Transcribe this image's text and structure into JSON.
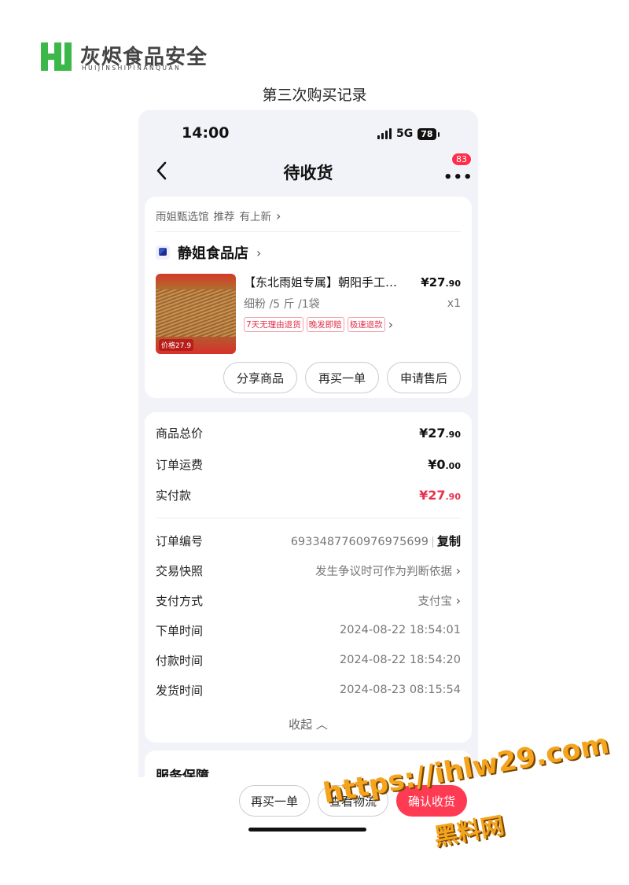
{
  "brand": {
    "name": "灰烬食品安全",
    "sub": "HUIJINSHIPINANQUAN",
    "color": "#3cb84a"
  },
  "caption": "第三次购买记录",
  "status": {
    "time": "14:00",
    "network": "5G",
    "battery": "78"
  },
  "nav": {
    "back_icon": "chevron-left-icon",
    "title": "待收货",
    "more_badge": "83"
  },
  "recommend": {
    "source": "雨姐甄选馆",
    "tag": "推荐",
    "new": "有上新"
  },
  "shop": {
    "name": "静姐食品店"
  },
  "product": {
    "title": "【东北雨姐专属】朝阳手工粉条",
    "price_int": "¥27",
    "price_dec": ".90",
    "spec": "细粉 /5 斤 /1袋",
    "qty": "x1",
    "img_price": "价格27.9",
    "tags": [
      "7天无理由退货",
      "晚发即赔",
      "极速退款"
    ]
  },
  "actions": {
    "share": "分享商品",
    "rebuy": "再买一单",
    "aftersale": "申请售后"
  },
  "summary": {
    "total_label": "商品总价",
    "total_int": "¥27",
    "total_dec": ".90",
    "ship_label": "订单运费",
    "ship_int": "¥0",
    "ship_dec": ".00",
    "paid_label": "实付款",
    "paid_int": "¥27",
    "paid_dec": ".90"
  },
  "details": {
    "order_no_label": "订单编号",
    "order_no": "6933487760976975699",
    "copy": "复制",
    "snapshot_label": "交易快照",
    "snapshot": "发生争议时可作为判断依据",
    "pay_label": "支付方式",
    "pay": "支付宝",
    "order_time_label": "下单时间",
    "order_time": "2024-08-22 18:54:01",
    "pay_time_label": "付款时间",
    "pay_time": "2024-08-22 18:54:20",
    "ship_time_label": "发货时间",
    "ship_time": "2024-08-23 08:15:54",
    "collapse": "收起"
  },
  "service": {
    "title": "服务保障"
  },
  "bottom": {
    "rebuy": "再买一单",
    "logistics": "查看物流",
    "confirm": "确认收货"
  },
  "watermark": {
    "url": "https://ihlw29.com",
    "name": "黑料网"
  },
  "colors": {
    "accent": "#ff3b53",
    "price_red": "#e8304c",
    "page_bg": "#f2f3f8"
  }
}
